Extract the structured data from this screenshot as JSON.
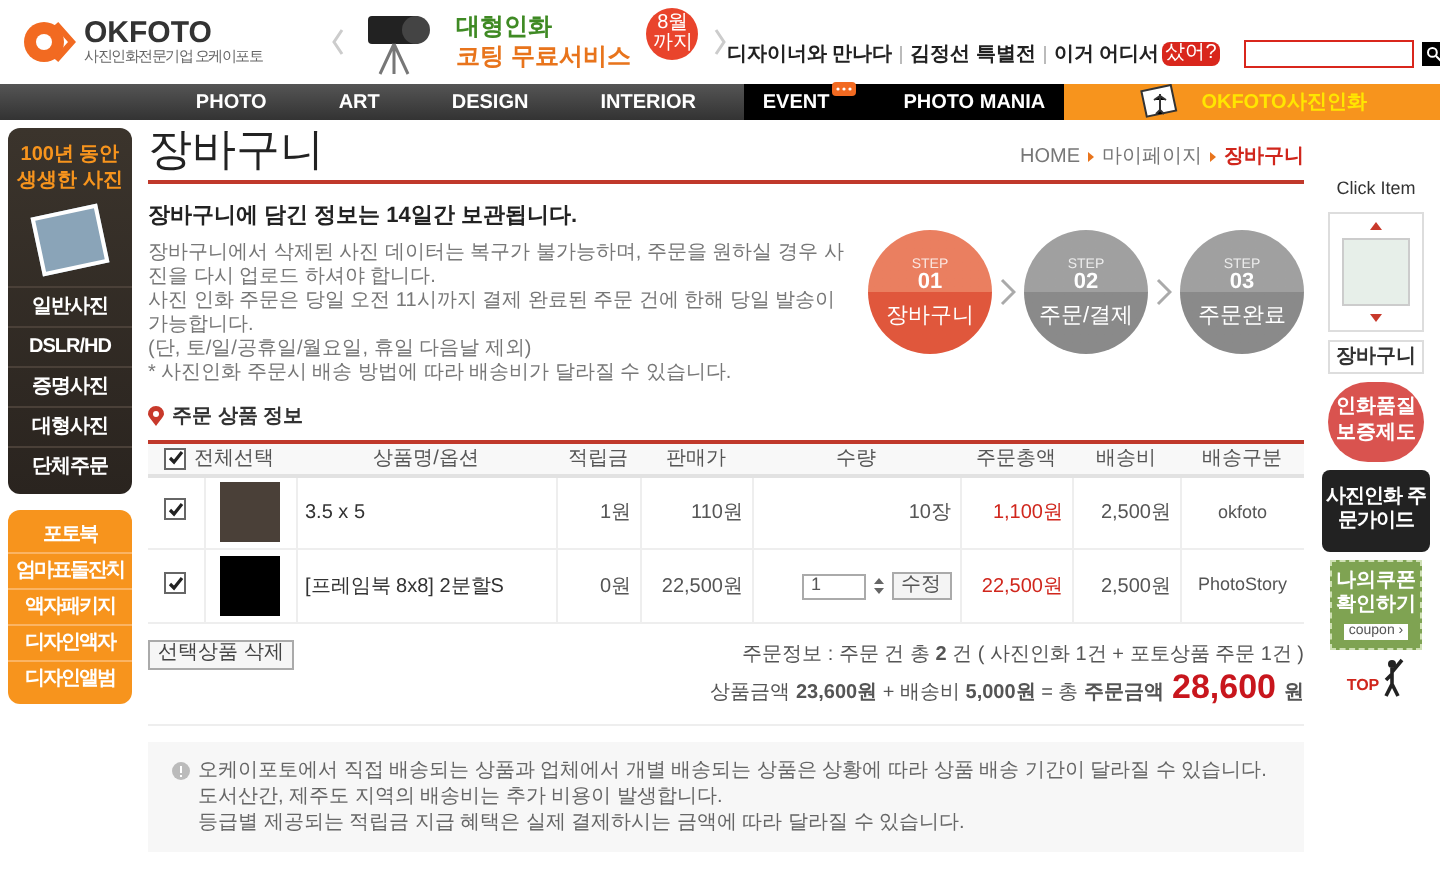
{
  "header": {
    "logo": "OKFOTO",
    "logo_tagline": "사진인화전문기업 오케이포토",
    "banner": {
      "line_1": "대형인화",
      "line_2": "코팅 무료서비스",
      "badge": "8월 까지"
    },
    "links": [
      {
        "label": "디자이너와 만나다"
      },
      {
        "label": "김정선 특별전"
      },
      {
        "label": "이거 어디서",
        "badge": "샀어?"
      }
    ]
  },
  "nav": [
    {
      "label": "PHOTO",
      "kind": "main",
      "bubble": false
    },
    {
      "label": "ART",
      "kind": "main",
      "bubble": false
    },
    {
      "label": "DESIGN",
      "kind": "main",
      "bubble": false
    },
    {
      "label": "INTERIOR",
      "kind": "main",
      "bubble": false
    },
    {
      "label": "EVENT",
      "kind": "dark",
      "bubble": true
    },
    {
      "label": "PHOTO MANIA",
      "kind": "dark",
      "bubble": false
    },
    {
      "label": "OKFOTO사진인화",
      "kind": "highlight",
      "bubble": false
    }
  ],
  "left_sidebar": {
    "tagline": "100년 동안 생생한 사진",
    "menu_1": [
      "일반사진",
      "DSLR/HD",
      "증명사진",
      "대형사진",
      "단체주문"
    ],
    "menu_2": [
      "포토북",
      "엄마표돌잔치",
      "액자패키지",
      "디자인액자",
      "디자인앨범"
    ]
  },
  "page": {
    "title": "장바구니",
    "breadcrumb": [
      {
        "label": "HOME",
        "selected": false
      },
      {
        "label": "마이페이지",
        "selected": false
      },
      {
        "label": "장바구니",
        "selected": true
      }
    ],
    "intro_heading": "장바구니에 담긴 정보는 14일간 보관됩니다.",
    "intro_lines": [
      "장바구니에서 삭제된 사진 데이터는 복구가 불가능하며, 주문을 원하실 경우 사진을 다시 업로드 하셔야 합니다.",
      "사진 인화 주문은 당일 오전 11시까지 결제 완료된 주문 건에 한해 당일 발송이 가능합니다.",
      "(단, 토/일/공휴일/월요일, 휴일 다음날 제외)",
      "* 사진인화 주문시 배송 방법에 따라 배송비가 달라질 수 있습니다."
    ],
    "steps": [
      {
        "caption": "STEP",
        "number": "01",
        "label": "장바구니",
        "selected": true
      },
      {
        "caption": "STEP",
        "number": "02",
        "label": "주문/결제",
        "selected": false
      },
      {
        "caption": "STEP",
        "number": "03",
        "label": "주문완료",
        "selected": false
      }
    ]
  },
  "cart": {
    "section_title": "주문 상품 정보",
    "select_all": {
      "label": "전체선택",
      "checked": true
    },
    "columns": [
      "상품명/옵션",
      "적립금",
      "판매가",
      "수량",
      "주문총액",
      "배송비",
      "배송구분"
    ],
    "rows": [
      {
        "checked": true,
        "name": "3.5 x 5",
        "points": "1원",
        "price": "110원",
        "quantity": "10장",
        "total": "1,100원",
        "shipping": "2,500원",
        "carrier": "okfoto"
      },
      {
        "checked": true,
        "name": "[프레임북 8x8] 2분할S",
        "points": "0원",
        "price": "22,500원",
        "quantity_field": {
          "value": "1",
          "button": "수정"
        },
        "total": "22,500원",
        "shipping": "2,500원",
        "carrier": "PhotoStory"
      }
    ],
    "delete_button": "선택상품 삭제",
    "summary_line": "주문정보 : 주문 건 총 **2** 건 ( 사진인화 1건 + 포토상품 주문 1건 )",
    "amount_line": "상품금액 **23,600원** + 배송비 **5,000원** = 총 **주문금액**",
    "grand_total": "28,600",
    "grand_total_unit": "원",
    "notes": [
      "오케이포토에서 직접 배송되는 상품과 업체에서 개별 배송되는 상품은 상황에 따라 상품 배송 기간이 달라질 수 있습니다.",
      "도서산간, 제주도 지역의 배송비는 추가 비용이 발생합니다.",
      "등급별 제공되는 적립금 지급 혜택은 실제 결제하시는 금액에 따라 달라질 수 있습니다."
    ]
  },
  "right_sidebar": {
    "title": "Click Item",
    "recent_label": "장바구니",
    "badge": "인화품질 보증제도",
    "guide": "사진인화 주문가이드",
    "coupon": "나의쿠폰 확인하기",
    "coupon_tag": "coupon ›",
    "top": "TOP"
  }
}
